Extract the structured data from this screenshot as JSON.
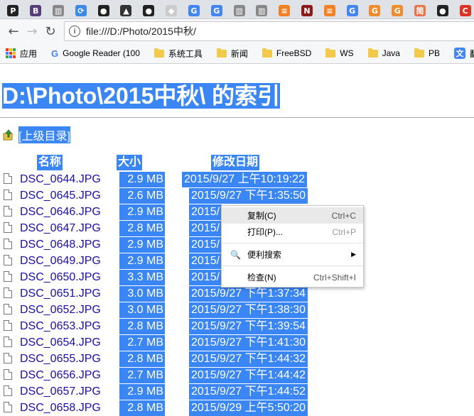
{
  "tabs": [
    {
      "icon": "script-p-icon",
      "glyph": "P",
      "bg": "#222"
    },
    {
      "icon": "bootstrap-icon",
      "glyph": "B",
      "bg": "#563d7c"
    },
    {
      "icon": "book-icon",
      "glyph": "▥",
      "bg": "#888"
    },
    {
      "icon": "loop-icon",
      "glyph": "⟳",
      "bg": "#3b8ae6"
    },
    {
      "icon": "github-icon",
      "glyph": "●",
      "bg": "#222"
    },
    {
      "icon": "drive-icon",
      "glyph": "▲",
      "bg": "#333"
    },
    {
      "icon": "github-icon",
      "glyph": "●",
      "bg": "#222"
    },
    {
      "icon": "cube-icon",
      "glyph": "◆",
      "bg": "#ccc"
    },
    {
      "icon": "google-icon",
      "glyph": "G",
      "bg": "#4285f4"
    },
    {
      "icon": "google-icon",
      "glyph": "G",
      "bg": "#4285f4"
    },
    {
      "icon": "book-icon",
      "glyph": "▥",
      "bg": "#888"
    },
    {
      "icon": "book-icon",
      "glyph": "▥",
      "bg": "#888"
    },
    {
      "icon": "stackoverflow-icon",
      "glyph": "≡",
      "bg": "#f48024"
    },
    {
      "icon": "n-icon",
      "glyph": "N",
      "bg": "#8b1a1a"
    },
    {
      "icon": "stackoverflow-icon",
      "glyph": "≡",
      "bg": "#f48024"
    },
    {
      "icon": "google-icon",
      "glyph": "G",
      "bg": "#4285f4"
    },
    {
      "icon": "g-orange-icon",
      "glyph": "G",
      "bg": "#f08b2e"
    },
    {
      "icon": "g-orange-icon",
      "glyph": "G",
      "bg": "#f08b2e"
    },
    {
      "icon": "jian-icon",
      "glyph": "简",
      "bg": "#e8744a"
    },
    {
      "icon": "github-icon",
      "glyph": "●",
      "bg": "#222"
    },
    {
      "icon": "c-red-icon",
      "glyph": "C",
      "bg": "#d32"
    }
  ],
  "omnibox": {
    "url": "file:///D:/Photo/2015中秋/"
  },
  "bookmarks": [
    {
      "label": "应用",
      "kind": "apps"
    },
    {
      "label": "Google Reader (100",
      "kind": "google"
    },
    {
      "label": "系统工具",
      "kind": "folder"
    },
    {
      "label": "新闻",
      "kind": "folder"
    },
    {
      "label": "FreeBSD",
      "kind": "folder"
    },
    {
      "label": "WS",
      "kind": "folder"
    },
    {
      "label": "Java",
      "kind": "folder"
    },
    {
      "label": "PB",
      "kind": "folder"
    },
    {
      "label": "翻译",
      "kind": "translate"
    }
  ],
  "page": {
    "title": "D:\\Photo\\2015中秋\\ 的索引",
    "parent_link": "[上级目录]",
    "headers": {
      "name": "名称",
      "size": "大小",
      "modified": "修改日期"
    },
    "files": [
      {
        "name": "DSC_0644.JPG",
        "size": "2.9 MB",
        "date": "2015/9/27 上午10:19:22"
      },
      {
        "name": "DSC_0645.JPG",
        "size": "2.6 MB",
        "date": "2015/9/27 下午1:35:50"
      },
      {
        "name": "DSC_0646.JPG",
        "size": "2.9 MB",
        "date": "2015/"
      },
      {
        "name": "DSC_0647.JPG",
        "size": "2.8 MB",
        "date": "2015/"
      },
      {
        "name": "DSC_0648.JPG",
        "size": "2.9 MB",
        "date": "2015/"
      },
      {
        "name": "DSC_0649.JPG",
        "size": "2.9 MB",
        "date": "2015/"
      },
      {
        "name": "DSC_0650.JPG",
        "size": "3.3 MB",
        "date": "2015/"
      },
      {
        "name": "DSC_0651.JPG",
        "size": "3.0 MB",
        "date": "2015/9/27 下午1:37:34"
      },
      {
        "name": "DSC_0652.JPG",
        "size": "3.0 MB",
        "date": "2015/9/27 下午1:38:30"
      },
      {
        "name": "DSC_0653.JPG",
        "size": "2.8 MB",
        "date": "2015/9/27 下午1:39:54"
      },
      {
        "name": "DSC_0654.JPG",
        "size": "2.7 MB",
        "date": "2015/9/27 下午1:41:30"
      },
      {
        "name": "DSC_0655.JPG",
        "size": "2.8 MB",
        "date": "2015/9/27 下午1:44:32"
      },
      {
        "name": "DSC_0656.JPG",
        "size": "2.7 MB",
        "date": "2015/9/27 下午1:44:42"
      },
      {
        "name": "DSC_0657.JPG",
        "size": "2.9 MB",
        "date": "2015/9/27 下午1:44:52"
      },
      {
        "name": "DSC_0658.JPG",
        "size": "2.8 MB",
        "date": "2015/9/29 上午5:50:20"
      }
    ]
  },
  "context_menu": [
    {
      "label": "复制(C)",
      "shortcut": "Ctrl+C",
      "highlighted": true
    },
    {
      "label": "打印(P)...",
      "shortcut": "Ctrl+P",
      "dim": true
    },
    {
      "sep": true
    },
    {
      "label": "便利搜索",
      "submenu": true,
      "icon": "magnifier-icon"
    },
    {
      "sep": true
    },
    {
      "label": "检查(N)",
      "shortcut": "Ctrl+Shift+I"
    }
  ],
  "colors": {
    "selection": "#3a86f5",
    "link": "#1a0dab"
  }
}
